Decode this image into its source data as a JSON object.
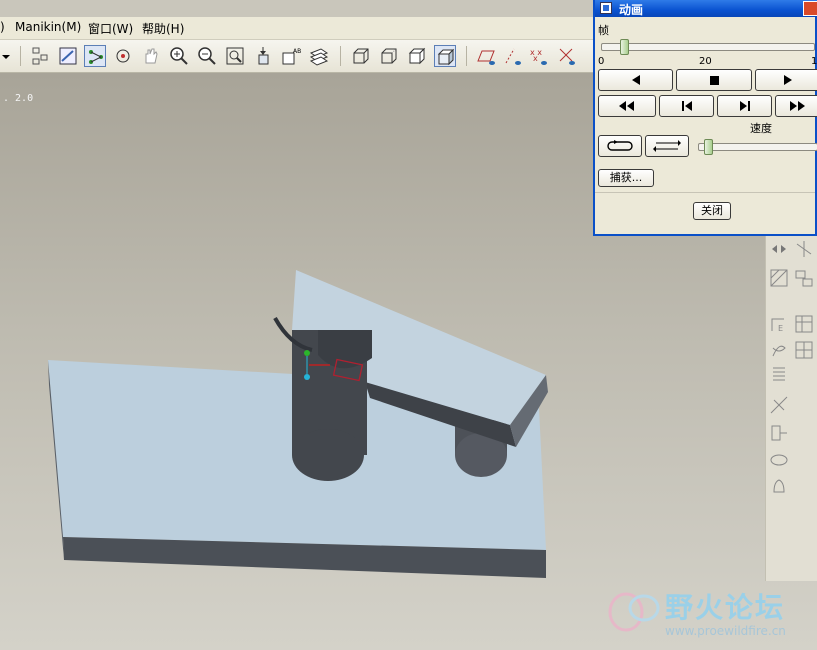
{
  "menu": {
    "manikin": "Manikin(M)",
    "window": "窗口(W)",
    "help": "帮助(H)"
  },
  "viewport": {
    "version_label": ". 2.0"
  },
  "dialog": {
    "title": "动画",
    "frame_label": "帧",
    "frame_ticks": [
      "0",
      "20",
      "1"
    ],
    "frame_position": 0.0,
    "speed_label": "速度",
    "speed_position": 0.0,
    "capture_label": "捕获...",
    "close_label": "关闭"
  },
  "watermark": {
    "brand": "野火论坛",
    "url": "www.proewildfire.cn"
  },
  "icons": {
    "toolbar": [
      "dropdown-arrow-icon",
      "layer-tree-icon",
      "sketch-view-icon",
      "datum-point-icon",
      "spin-center-icon",
      "pan-hand-icon",
      "zoom-in-icon",
      "zoom-out-icon",
      "refit-icon",
      "orient-icon",
      "named-view-icon",
      "layers-icon",
      "wireframe-icon",
      "hidden-line-icon",
      "no-hidden-icon",
      "shading-icon",
      "datum-plane-icon",
      "datum-axis-icon",
      "point-display-icon",
      "csys-display-icon"
    ],
    "rightbar": [
      "mirror-icon",
      "datum-icon",
      "pattern-icon",
      "dimension-icon",
      "round-icon",
      "spring-icon",
      "table-icon",
      "trim-icon",
      "insert-icon",
      "layer-icon",
      "bell-icon"
    ]
  }
}
